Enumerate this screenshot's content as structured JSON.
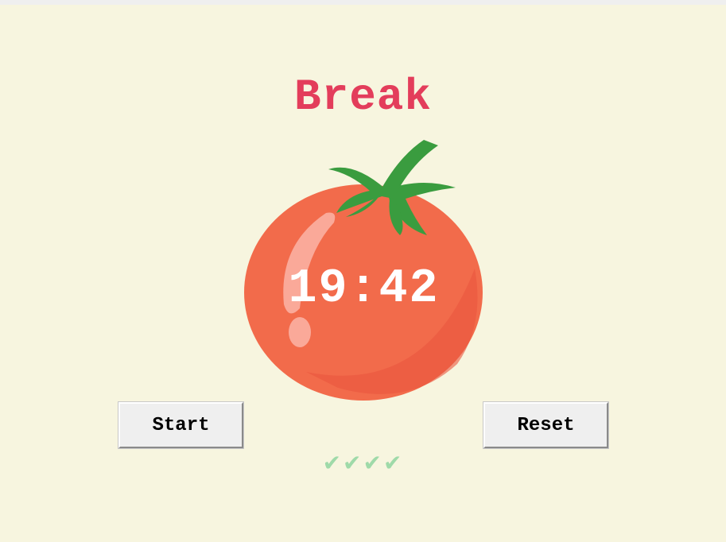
{
  "mode_title": "Break",
  "timer": {
    "display": "19:42"
  },
  "buttons": {
    "start": "Start",
    "reset": "Reset"
  },
  "sessions": {
    "checkmarks": "✔✔✔✔",
    "completed_count": 4
  },
  "colors": {
    "background": "#f7f5df",
    "title": "#e33d5b",
    "tomato": "#f26b4b",
    "leaf": "#3a9c3f",
    "check": "#9fdaa9"
  },
  "icons": {
    "tomato": "tomato-icon",
    "checkmark": "checkmark-icon"
  }
}
